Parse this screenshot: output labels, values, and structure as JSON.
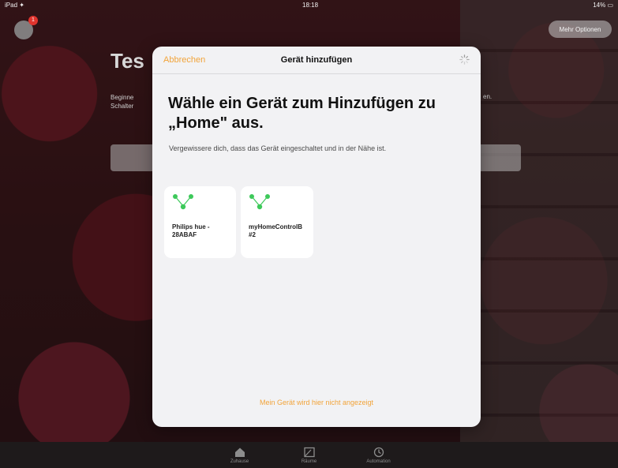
{
  "status_bar": {
    "left": "iPad ✦",
    "time": "18:18",
    "right": "14% ▭"
  },
  "background_page": {
    "badge_count": "1",
    "top_right_button": "Mehr Optionen",
    "title": "Tes",
    "text_left": "Beginne Schalter",
    "text_right": "en."
  },
  "modal": {
    "cancel_label": "Abbrechen",
    "title": "Gerät hinzufügen",
    "heading": "Wähle ein Gerät zum Hinzufügen zu „Home\" aus.",
    "subtext": "Vergewissere dich, dass das Gerät eingeschaltet und in der Nähe ist.",
    "devices": [
      {
        "label": "Philips hue - 28ABAF",
        "icon": "bridge-icon"
      },
      {
        "label": "myHomeControlB #2",
        "icon": "bridge-icon"
      }
    ],
    "not_shown_link": "Mein Gerät wird hier nicht angezeigt"
  },
  "tabbar": {
    "tabs": [
      {
        "label": "Zuhause",
        "icon": "home-icon"
      },
      {
        "label": "Räume",
        "icon": "rooms-icon"
      },
      {
        "label": "Automation",
        "icon": "automation-icon"
      }
    ]
  },
  "colors": {
    "accent": "#f2a43a",
    "device_dot": "#3dc95a"
  }
}
